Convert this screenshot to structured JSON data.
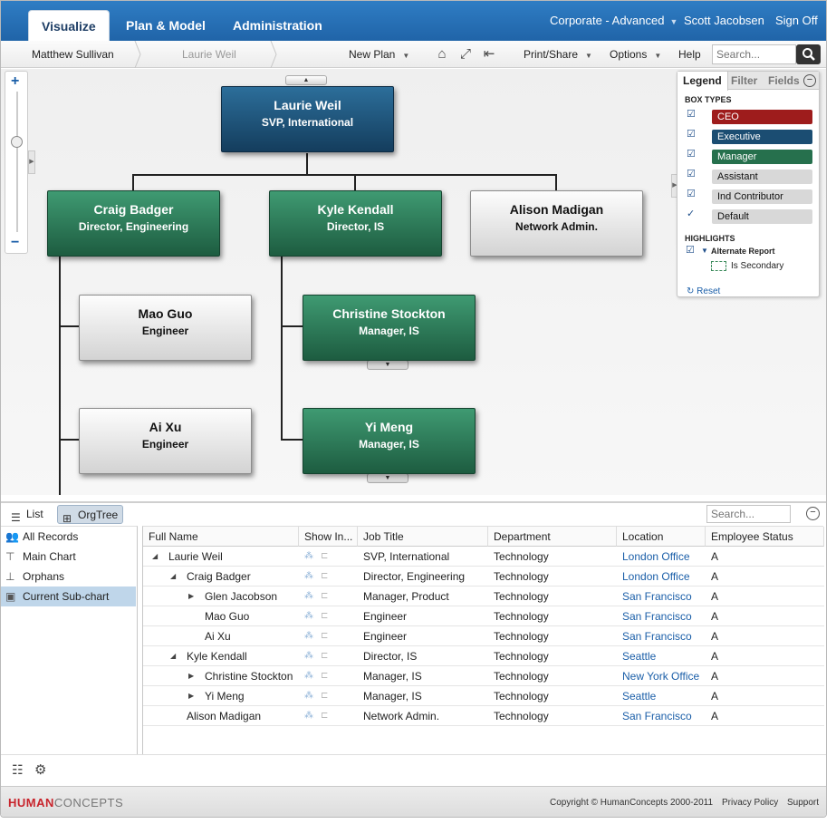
{
  "topbar": {
    "tabs": [
      {
        "label": "Visualize",
        "active": true
      },
      {
        "label": "Plan & Model",
        "active": false
      },
      {
        "label": "Administration",
        "active": false
      }
    ],
    "org_selector": "Corporate - Advanced",
    "user": "Scott Jacobsen",
    "sign_off": "Sign Off"
  },
  "toolbar": {
    "breadcrumbs": [
      "Matthew Sullivan",
      "Laurie Weil"
    ],
    "new_plan": "New Plan",
    "print_share": "Print/Share",
    "options": "Options",
    "help": "Help",
    "search_placeholder": "Search..."
  },
  "chart": {
    "root": {
      "name": "Laurie Weil",
      "title": "SVP, International",
      "type": "Executive"
    },
    "level1": [
      {
        "name": "Craig Badger",
        "title": "Director, Engineering",
        "type": "Manager"
      },
      {
        "name": "Kyle Kendall",
        "title": "Director, IS",
        "type": "Manager"
      },
      {
        "name": "Alison Madigan",
        "title": "Network Admin.",
        "type": "Ind Contributor"
      }
    ],
    "craig_reports": [
      {
        "name": "Mao Guo",
        "title": "Engineer",
        "type": "Ind Contributor"
      },
      {
        "name": "Ai Xu",
        "title": "Engineer",
        "type": "Ind Contributor"
      }
    ],
    "kyle_reports": [
      {
        "name": "Christine Stockton",
        "title": "Manager, IS",
        "type": "Manager"
      },
      {
        "name": "Yi Meng",
        "title": "Manager, IS",
        "type": "Manager"
      }
    ]
  },
  "legend": {
    "tabs": [
      "Legend",
      "Filter",
      "Fields"
    ],
    "box_types_heading": "BOX TYPES",
    "box_types": [
      {
        "label": "CEO",
        "color": "#9e1c1c"
      },
      {
        "label": "Executive",
        "color": "#1b4d72"
      },
      {
        "label": "Manager",
        "color": "#26704d"
      },
      {
        "label": "Assistant",
        "color": "#d8d8d8"
      },
      {
        "label": "Ind Contributor",
        "color": "#d8d8d8"
      },
      {
        "label": "Default",
        "color": "#d8d8d8"
      }
    ],
    "highlights_heading": "HIGHLIGHTS",
    "alternate_report": "Alternate Report",
    "is_secondary": "Is Secondary",
    "reset": "Reset"
  },
  "bottom": {
    "view_list": "List",
    "view_orgtree": "OrgTree",
    "search_placeholder": "Search...",
    "tree": [
      "All Records",
      "Main Chart",
      "Orphans",
      "Current Sub-chart"
    ],
    "columns": [
      "Full Name",
      "Show In...",
      "Job Title",
      "Department",
      "Location",
      "Employee Status"
    ],
    "rows": [
      {
        "name": "Laurie Weil",
        "indent": 0,
        "toggle": "expanded",
        "title": "SVP, International",
        "dept": "Technology",
        "loc": "London Office",
        "status": "A"
      },
      {
        "name": "Craig Badger",
        "indent": 1,
        "toggle": "expanded",
        "title": "Director, Engineering",
        "dept": "Technology",
        "loc": "London Office",
        "status": "A"
      },
      {
        "name": "Glen Jacobson",
        "indent": 2,
        "toggle": "collapsed",
        "title": "Manager, Product",
        "dept": "Technology",
        "loc": "San Francisco",
        "status": "A"
      },
      {
        "name": "Mao Guo",
        "indent": 2,
        "toggle": "none",
        "title": "Engineer",
        "dept": "Technology",
        "loc": "San Francisco",
        "status": "A"
      },
      {
        "name": "Ai Xu",
        "indent": 2,
        "toggle": "none",
        "title": "Engineer",
        "dept": "Technology",
        "loc": "San Francisco",
        "status": "A"
      },
      {
        "name": "Kyle Kendall",
        "indent": 1,
        "toggle": "expanded",
        "title": "Director, IS",
        "dept": "Technology",
        "loc": "Seattle",
        "status": "A"
      },
      {
        "name": "Christine Stockton",
        "indent": 2,
        "toggle": "collapsed",
        "title": "Manager, IS",
        "dept": "Technology",
        "loc": "New York Office",
        "status": "A"
      },
      {
        "name": "Yi Meng",
        "indent": 2,
        "toggle": "collapsed",
        "title": "Manager, IS",
        "dept": "Technology",
        "loc": "Seattle",
        "status": "A"
      },
      {
        "name": "Alison Madigan",
        "indent": 1,
        "toggle": "none",
        "title": "Network Admin.",
        "dept": "Technology",
        "loc": "San Francisco",
        "status": "A"
      }
    ]
  },
  "footer": {
    "logo_human": "HUMAN",
    "logo_concepts": "CONCEPTS",
    "copyright": "Copyright © HumanConcepts 2000-2011",
    "privacy": "Privacy Policy",
    "support": "Support"
  }
}
